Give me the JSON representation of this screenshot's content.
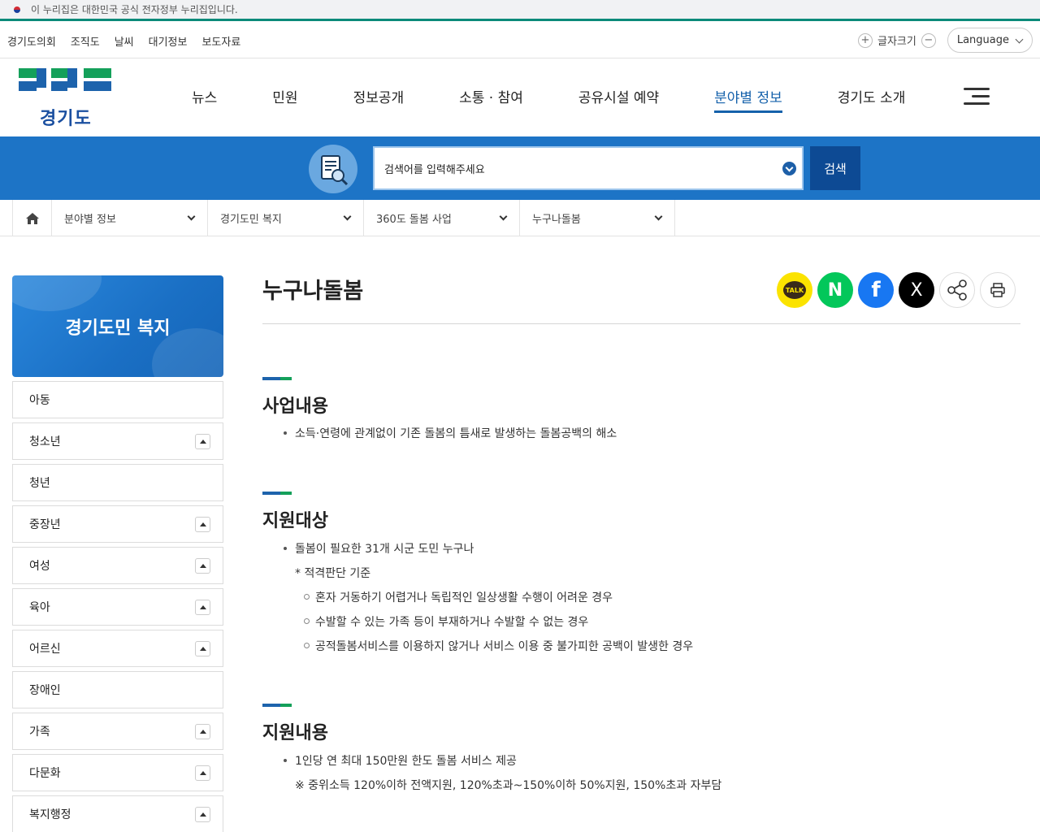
{
  "gov_banner": {
    "text": "이 누리집은 대한민국 공식 전자정부 누리집입니다."
  },
  "util_links": [
    "경기도의회",
    "조직도",
    "날씨",
    "대기정보",
    "보도자료"
  ],
  "font_size": {
    "label": "글자크기",
    "plus": "+",
    "minus": "−"
  },
  "language": {
    "label": "Language"
  },
  "logo": {
    "text": "경기도"
  },
  "gnb": [
    {
      "label": "뉴스"
    },
    {
      "label": "민원"
    },
    {
      "label": "정보공개"
    },
    {
      "label": "소통 · 참여"
    },
    {
      "label": "공유시설 예약"
    },
    {
      "label": "분야별 정보",
      "active": true
    },
    {
      "label": "경기도 소개"
    }
  ],
  "search": {
    "placeholder": "검색어를 입력해주세요",
    "button": "검색"
  },
  "breadcrumb": [
    "분야별 정보",
    "경기도민 복지",
    "360도 돌봄 사업",
    "누구나돌봄"
  ],
  "sidebar": {
    "title": "경기도민 복지",
    "items": [
      {
        "label": "아동",
        "toggle": false
      },
      {
        "label": "청소년",
        "toggle": true
      },
      {
        "label": "청년",
        "toggle": false
      },
      {
        "label": "중장년",
        "toggle": true
      },
      {
        "label": "여성",
        "toggle": true
      },
      {
        "label": "육아",
        "toggle": true
      },
      {
        "label": "어르신",
        "toggle": true
      },
      {
        "label": "장애인",
        "toggle": false
      },
      {
        "label": "가족",
        "toggle": true
      },
      {
        "label": "다문화",
        "toggle": true
      },
      {
        "label": "복지행정",
        "toggle": true
      }
    ]
  },
  "page": {
    "title": "누구나돌봄"
  },
  "share": {
    "kakao": "TALK",
    "naver": "N",
    "facebook": "f",
    "x": "X"
  },
  "sections": {
    "s1": {
      "title": "사업내용",
      "bullet": "소득·연령에 관계없이 기존 돌봄의 틈새로 발생하는 돌봄공백의 해소"
    },
    "s2": {
      "title": "지원대상",
      "bullet": "돌봄이 필요한 31개 시군 도민 누구나",
      "note": "* 적격판단 기준",
      "items": [
        "혼자 거동하기 어렵거나 독립적인 일상생활 수행이 어려운 경우",
        "수발할 수 있는 가족 등이 부재하거나 수발할 수 없는 경우",
        "공적돌봄서비스를 이용하지 않거나 서비스 이용 중 불가피한 공백이 발생한 경우"
      ]
    },
    "s3": {
      "title": "지원내용",
      "bullet": "1인당 연 최대 150만원 한도 돌봄 서비스 제공",
      "note": "※ 중위소득 120%이하 전액지원, 120%초과~150%이하 50%지원, 150%초과 자부담"
    }
  },
  "colors": {
    "primary": "#1d74c6",
    "navy": "#0d4a94",
    "green": "#14a05a",
    "active": "#1561ab"
  }
}
